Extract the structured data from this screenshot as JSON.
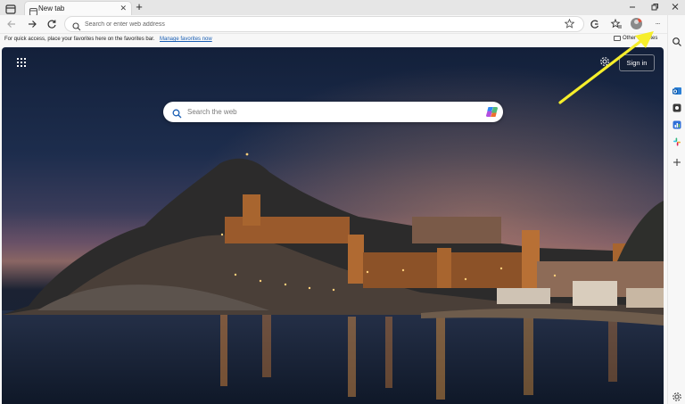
{
  "window": {
    "tab_actions_icon": "tab-actions-icon",
    "minimize_icon": "minimize-icon",
    "restore_icon": "restore-icon",
    "close_icon": "close-icon"
  },
  "tab": {
    "title": "New tab",
    "icon": "new-tab-page-icon",
    "close_glyph": "✕"
  },
  "new_tab_button": "+",
  "toolbar": {
    "back_icon": "back-arrow-icon",
    "forward_icon": "forward-arrow-icon",
    "refresh_icon": "refresh-icon",
    "address_placeholder": "Search or enter web address",
    "favorite_icon": "star-icon",
    "right_icons": [
      "browser-essentials-icon",
      "favorites-icon",
      "profile-avatar",
      "more-menu-icon",
      "copilot-icon"
    ],
    "more_glyph": "···"
  },
  "favorites_bar": {
    "message": "For quick access, place your favorites here on the favorites bar.",
    "manage_link": "Manage favorites now",
    "other_favorites": "Other favorites"
  },
  "page": {
    "apps_icon": "app-launcher-icon",
    "settings_icon": "gear-icon",
    "sign_in": "Sign in",
    "search_placeholder": "Search the web",
    "copilot_icon": "copilot-icon"
  },
  "sidebar": {
    "icons": [
      "search-icon",
      "outlook-icon",
      "screenshot-icon",
      "tools-icon",
      "slack-icon",
      "add-icon",
      "settings-icon"
    ]
  },
  "annotation": {
    "arrow_color": "#f6ee2b"
  },
  "colors": {
    "accent": "#1a5fb4",
    "frame": "#f7f7f7"
  }
}
